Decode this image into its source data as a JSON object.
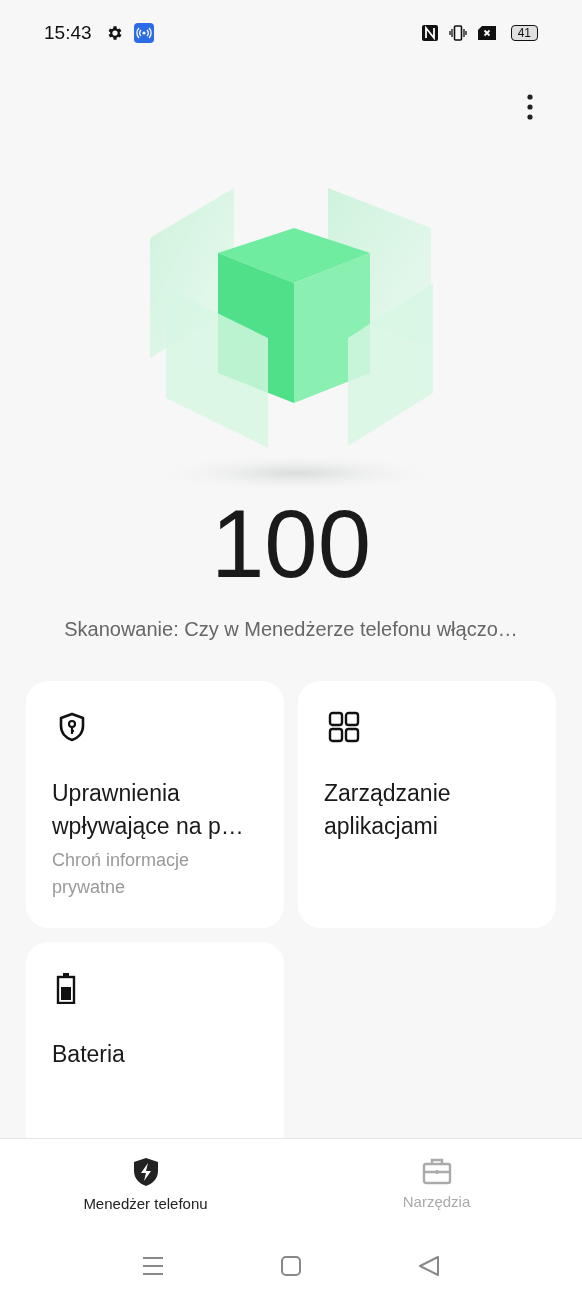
{
  "status_bar": {
    "time": "15:43",
    "battery": "41"
  },
  "score": "100",
  "scan_text": "Skanowanie: Czy w Menedżerze telefonu włączo…",
  "cards": [
    {
      "title": "Uprawnienia wpływające na p…",
      "subtitle": "Chroń informacje prywatne"
    },
    {
      "title": "Zarządzanie aplikacjami"
    },
    {
      "title": "Bateria"
    }
  ],
  "bottom_tabs": [
    {
      "label": "Menedżer telefonu",
      "selected": true
    },
    {
      "label": "Narzędzia",
      "selected": false
    }
  ]
}
